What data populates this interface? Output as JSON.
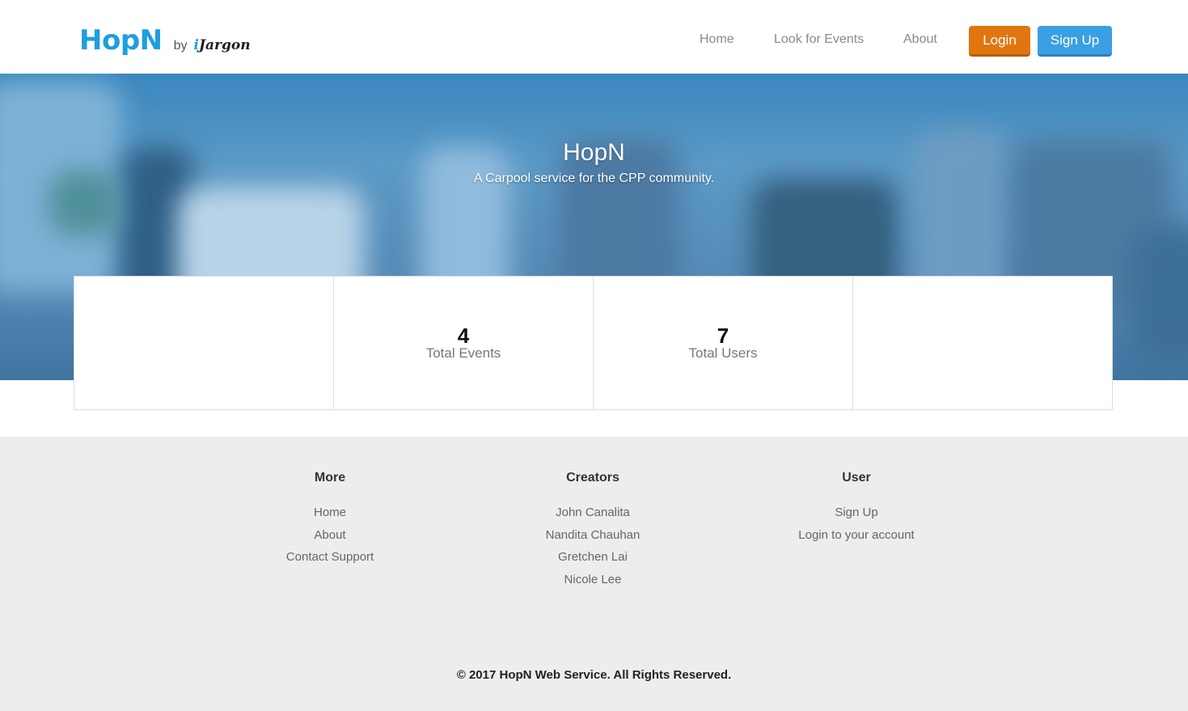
{
  "header": {
    "logo_main": "HopN",
    "logo_by": "by",
    "logo_brand_i": "i",
    "logo_brand_rest": "Jargon",
    "nav": {
      "home": "Home",
      "events": "Look for Events",
      "about": "About"
    },
    "login_label": "Login",
    "signup_label": "Sign Up"
  },
  "hero": {
    "title": "HopN",
    "subtitle": "A Carpool service for the CPP community."
  },
  "stats": {
    "events_value": "4",
    "events_label": "Total Events",
    "users_value": "7",
    "users_label": "Total Users"
  },
  "footer": {
    "more": {
      "heading": "More",
      "links": [
        "Home",
        "About",
        "Contact Support"
      ]
    },
    "creators": {
      "heading": "Creators",
      "links": [
        "John Canalita",
        "Nandita Chauhan",
        "Gretchen Lai",
        "Nicole Lee"
      ]
    },
    "user": {
      "heading": "User",
      "links": [
        "Sign Up",
        "Login to your account"
      ]
    },
    "copyright": "© 2017 HopN Web Service. All Rights Reserved."
  },
  "colors": {
    "brand_blue": "#1e9ee0",
    "login_orange": "#e07610",
    "signup_blue": "#3a9fe3",
    "footer_bg": "#ededed"
  }
}
